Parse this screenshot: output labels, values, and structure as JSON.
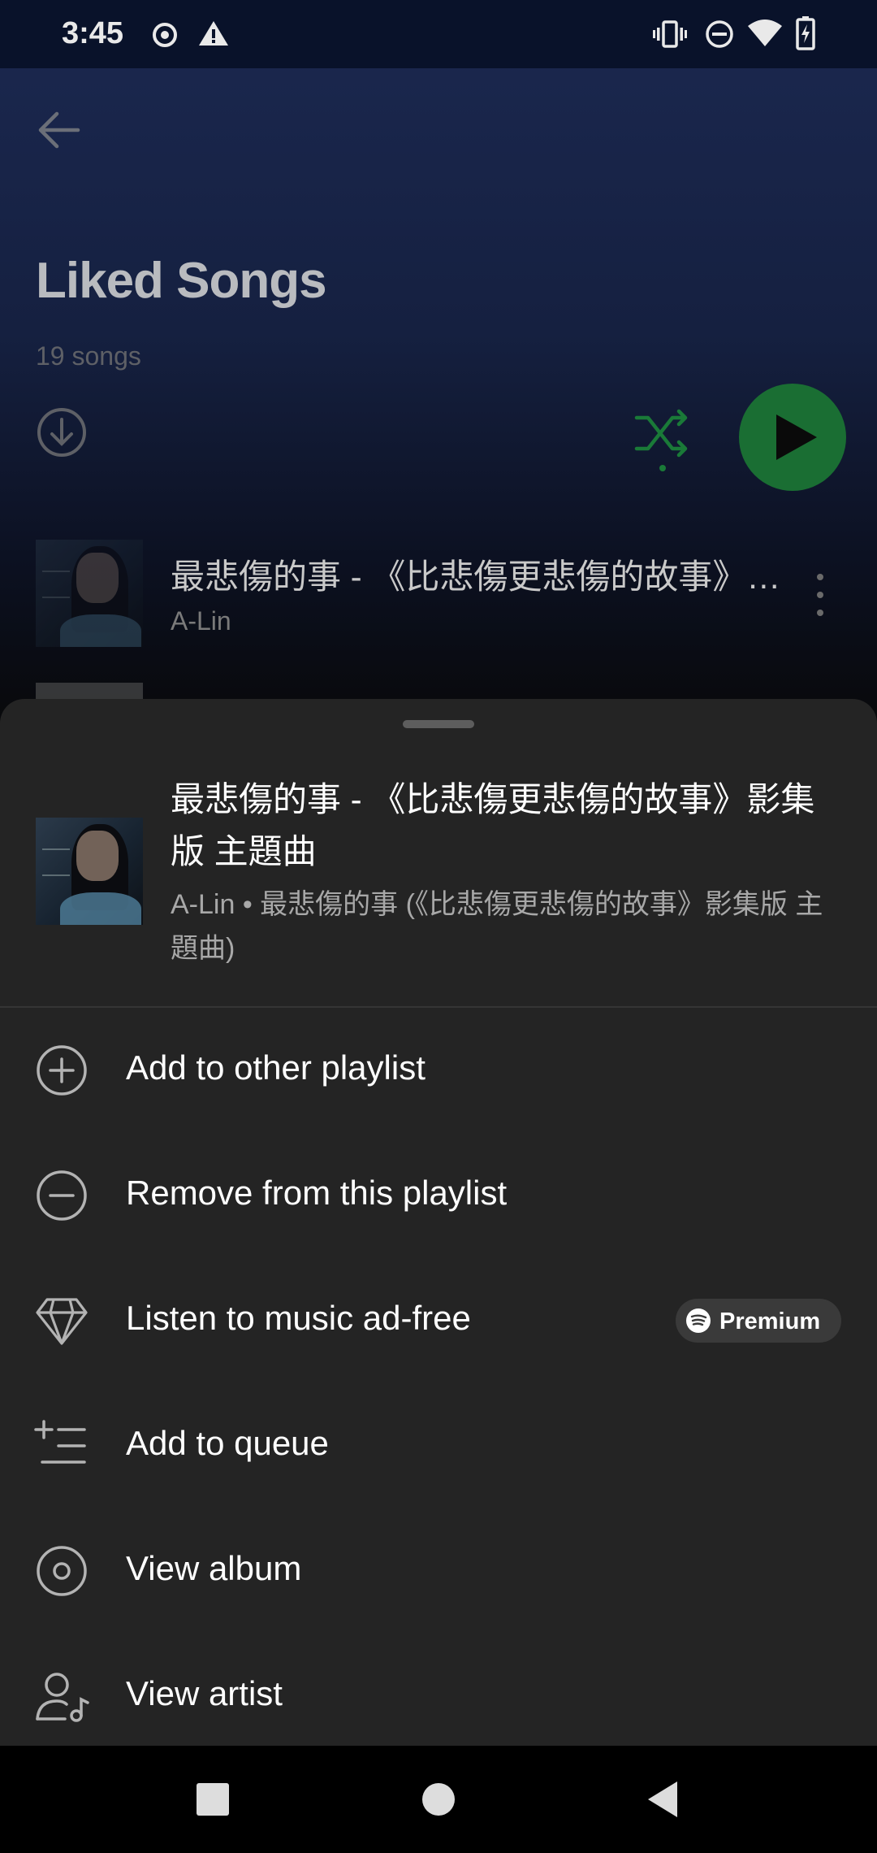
{
  "status_bar": {
    "time": "3:45",
    "left_icons": [
      "record-icon",
      "alert-icon"
    ],
    "right_icons": [
      "vibrate-icon",
      "do-not-disturb-icon",
      "wifi-icon",
      "battery-charging-icon"
    ]
  },
  "header": {
    "title": "Liked Songs",
    "subtitle": "19 songs"
  },
  "playlist_preview": {
    "track_title": "最悲傷的事 - 《比悲傷更悲傷的故事》影集版 主題曲",
    "track_artist": "A-Lin"
  },
  "sheet": {
    "song_title": "最悲傷的事 - 《比悲傷更悲傷的故事》影集版 主題曲",
    "song_subtitle": "A-Lin • 最悲傷的事 (《比悲傷更悲傷的故事》影集版 主題曲)",
    "menu": [
      {
        "label": "Add to other playlist",
        "icon": "add-circle-icon"
      },
      {
        "label": "Remove from this playlist",
        "icon": "remove-circle-icon"
      },
      {
        "label": "Listen to music ad-free",
        "icon": "diamond-icon",
        "badge": "Premium"
      },
      {
        "label": "Add to queue",
        "icon": "add-to-queue-icon"
      },
      {
        "label": "View album",
        "icon": "album-icon"
      },
      {
        "label": "View artist",
        "icon": "artist-icon"
      }
    ]
  },
  "colors": {
    "accent_green": "#1db954",
    "sheet_bg": "#242424"
  }
}
